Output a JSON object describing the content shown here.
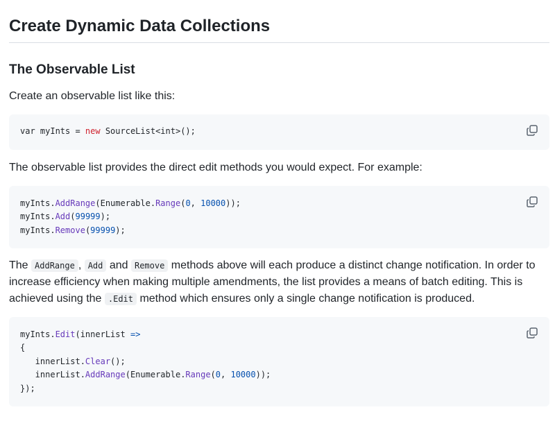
{
  "title": "Create Dynamic Data Collections",
  "section": {
    "heading": "The Observable List",
    "intro": "Create an observable list like this:",
    "code1": {
      "l1_a": "var myInts = ",
      "l1_new": "new",
      "l1_b": " SourceList<int>();"
    },
    "para2": "The observable list provides the direct edit methods you would expect. For example:",
    "code2": {
      "l1_a": "myInts.",
      "l1_fn": "AddRange",
      "l1_b": "(Enumerable.",
      "l1_fn2": "Range",
      "l1_c": "(",
      "l1_n1": "0",
      "l1_d": ", ",
      "l1_n2": "10000",
      "l1_e": "));",
      "l2_a": "myInts.",
      "l2_fn": "Add",
      "l2_b": "(",
      "l2_n": "99999",
      "l2_c": ");",
      "l3_a": "myInts.",
      "l3_fn": "Remove",
      "l3_b": "(",
      "l3_n": "99999",
      "l3_c": ");"
    },
    "para3": {
      "t1": "The ",
      "c1": "AddRange",
      "t2": ", ",
      "c2": "Add",
      "t3": " and ",
      "c3": "Remove",
      "t4": " methods above will each produce a distinct change notification. In order to increase efficiency when making multiple amendments, the list provides a means of batch editing. This is achieved using the ",
      "c4": ".Edit",
      "t5": " method which ensures only a single change notification is produced."
    },
    "code3": {
      "l1_a": "myInts.",
      "l1_fn": "Edit",
      "l1_b": "(innerList ",
      "l1_op": "=>",
      "l2": "{",
      "l3_a": "   innerList.",
      "l3_fn": "Clear",
      "l3_b": "();",
      "l4_a": "   innerList.",
      "l4_fn": "AddRange",
      "l4_b": "(Enumerable.",
      "l4_fn2": "Range",
      "l4_c": "(",
      "l4_n1": "0",
      "l4_d": ", ",
      "l4_n2": "10000",
      "l4_e": "));",
      "l5": "});"
    }
  },
  "icons": {
    "copy": "copy-icon"
  }
}
